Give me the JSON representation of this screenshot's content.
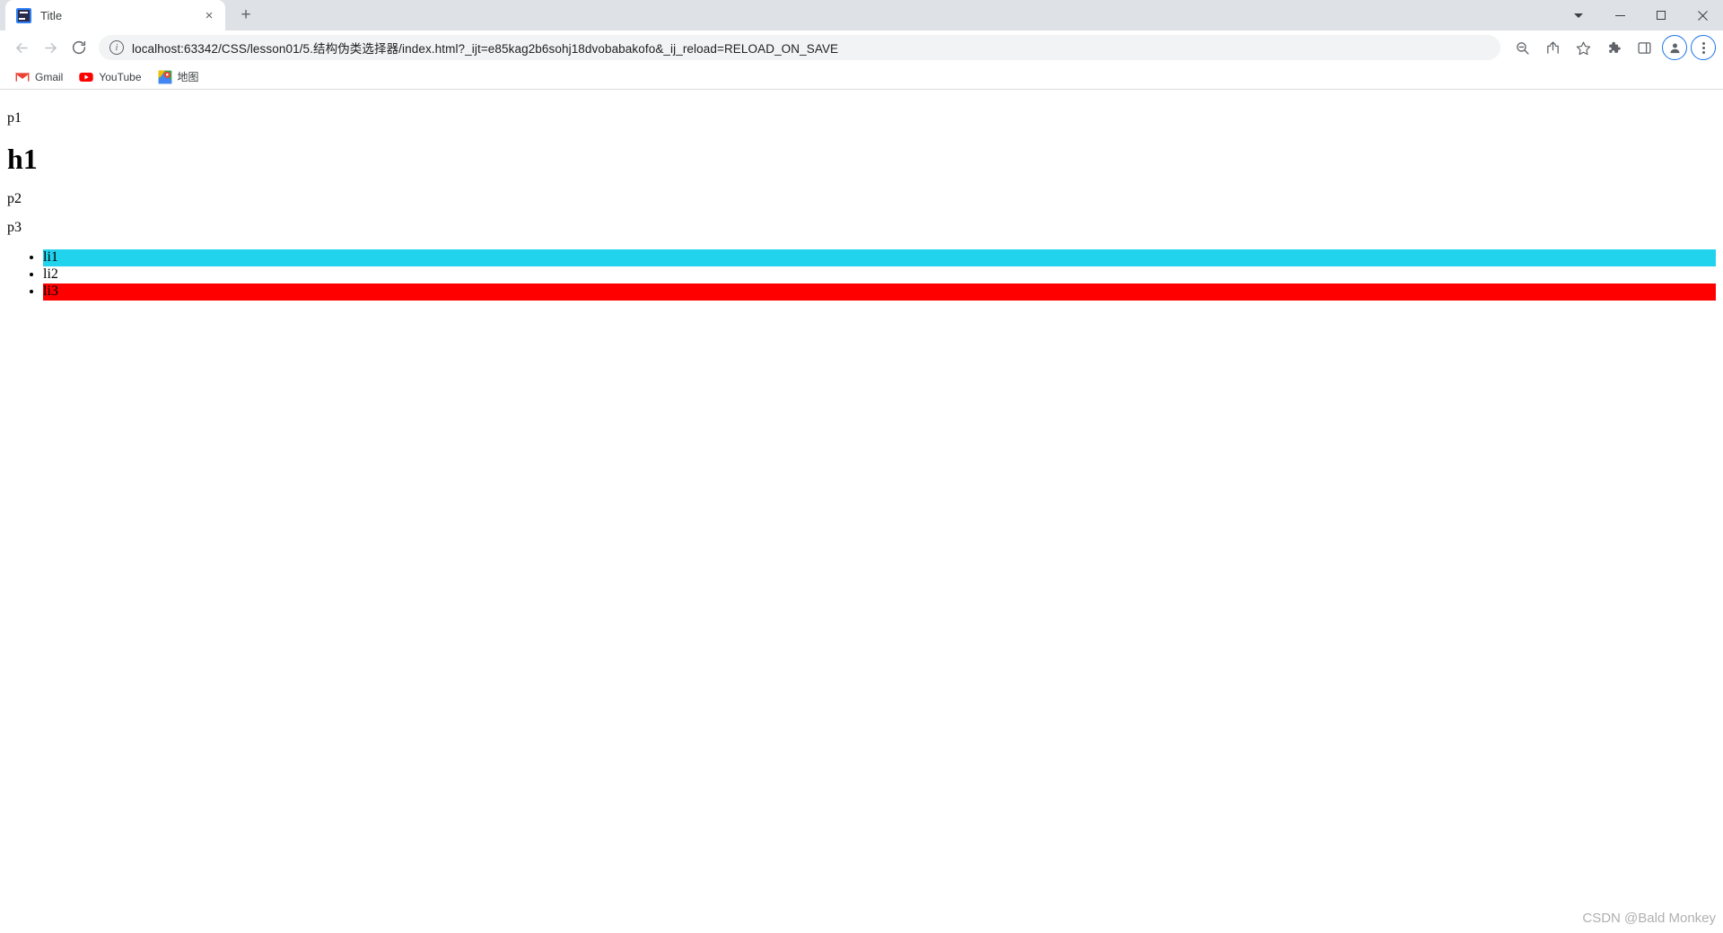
{
  "window": {
    "minimize_label": "Minimize",
    "maximize_label": "Maximize",
    "close_label": "Close",
    "tab_search_label": "Search tabs"
  },
  "tabs": [
    {
      "title": "Title",
      "favicon": "intellij-idea-icon",
      "close_label": "×"
    }
  ],
  "new_tab_label": "+",
  "toolbar": {
    "back_label": "Back",
    "forward_label": "Forward",
    "reload_label": "Reload",
    "site_info_label": "i",
    "url": "localhost:63342/CSS/lesson01/5.结构伪类选择器/index.html?_ijt=e85kag2b6sohj18dvobabakofo&_ij_reload=RELOAD_ON_SAVE",
    "url_placeholder": "Search Google or type a URL",
    "zoom_label": "Zoom",
    "share_label": "Share this page",
    "bookmark_label": "Bookmark this tab",
    "extensions_label": "Extensions",
    "sidepanel_label": "Side panel",
    "profile_label": "Profile",
    "menu_label": "Customize and control Google Chrome"
  },
  "bookmarks": [
    {
      "label": "Gmail",
      "icon": "gmail-icon"
    },
    {
      "label": "YouTube",
      "icon": "youtube-icon"
    },
    {
      "label": "地图",
      "icon": "google-maps-icon"
    }
  ],
  "page": {
    "paragraph1": "p1",
    "heading1": "h1",
    "paragraph2": "p2",
    "paragraph3": "p3",
    "list_items": [
      {
        "text": "li1",
        "background": "#22d3ee",
        "color": "#000000"
      },
      {
        "text": "li2",
        "background": "transparent",
        "color": "#000000"
      },
      {
        "text": "li3",
        "background": "#fe0000",
        "color": "#000000"
      }
    ],
    "watermark": "CSDN @Bald Monkey"
  },
  "colors": {
    "chrome_tabstrip": "#dee1e6",
    "omnibox": "#f1f3f4",
    "accent_blue": "#1a73e8",
    "li1_cyan": "#22d3ee",
    "li3_red": "#fe0000"
  }
}
